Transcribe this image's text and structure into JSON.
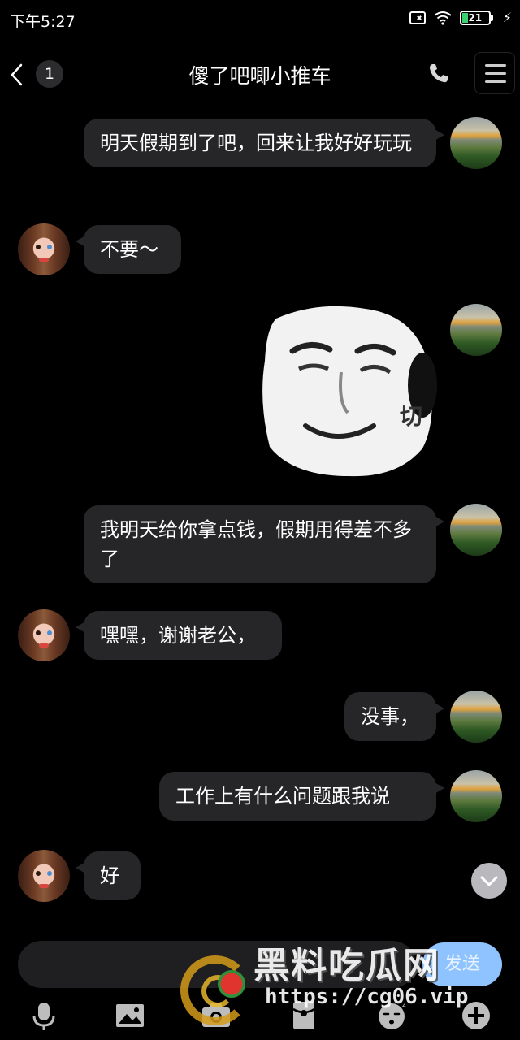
{
  "status_bar": {
    "time": "下午5:27",
    "battery_level": "21",
    "battery_percent": 21
  },
  "header": {
    "back_icon": "chevron-left-icon",
    "unread_count": "1",
    "title": "傻了吧唧小推车",
    "call_icon": "phone-icon",
    "menu_icon": "hamburger-menu-icon"
  },
  "messages": [
    {
      "side": "right",
      "type": "text",
      "text": "明天假期到了吧，回来让我好好玩玩"
    },
    {
      "side": "left",
      "type": "text",
      "text": "不要～"
    },
    {
      "side": "right",
      "type": "sticker",
      "caption": "切"
    },
    {
      "side": "right",
      "type": "text",
      "text": "我明天给你拿点钱，假期用得差不多了"
    },
    {
      "side": "left",
      "type": "text",
      "text": "嘿嘿，谢谢老公，"
    },
    {
      "side": "right",
      "type": "text",
      "text": "没事，"
    },
    {
      "side": "right",
      "type": "text",
      "text": "工作上有什么问题跟我说"
    },
    {
      "side": "left",
      "type": "text",
      "text": "好"
    }
  ],
  "input": {
    "send_label": "发送"
  },
  "toolbar": {
    "items": [
      "microphone-icon",
      "image-icon",
      "camera-icon",
      "red-packet-icon",
      "emoji-icon",
      "plus-icon"
    ]
  },
  "watermark": {
    "title": "黑料吃瓜网",
    "url": "https://cg06.vip"
  },
  "colors": {
    "background": "#000000",
    "bubble": "#262628",
    "send_button": "#8ec3ff",
    "battery_fill": "#3bd16f"
  }
}
